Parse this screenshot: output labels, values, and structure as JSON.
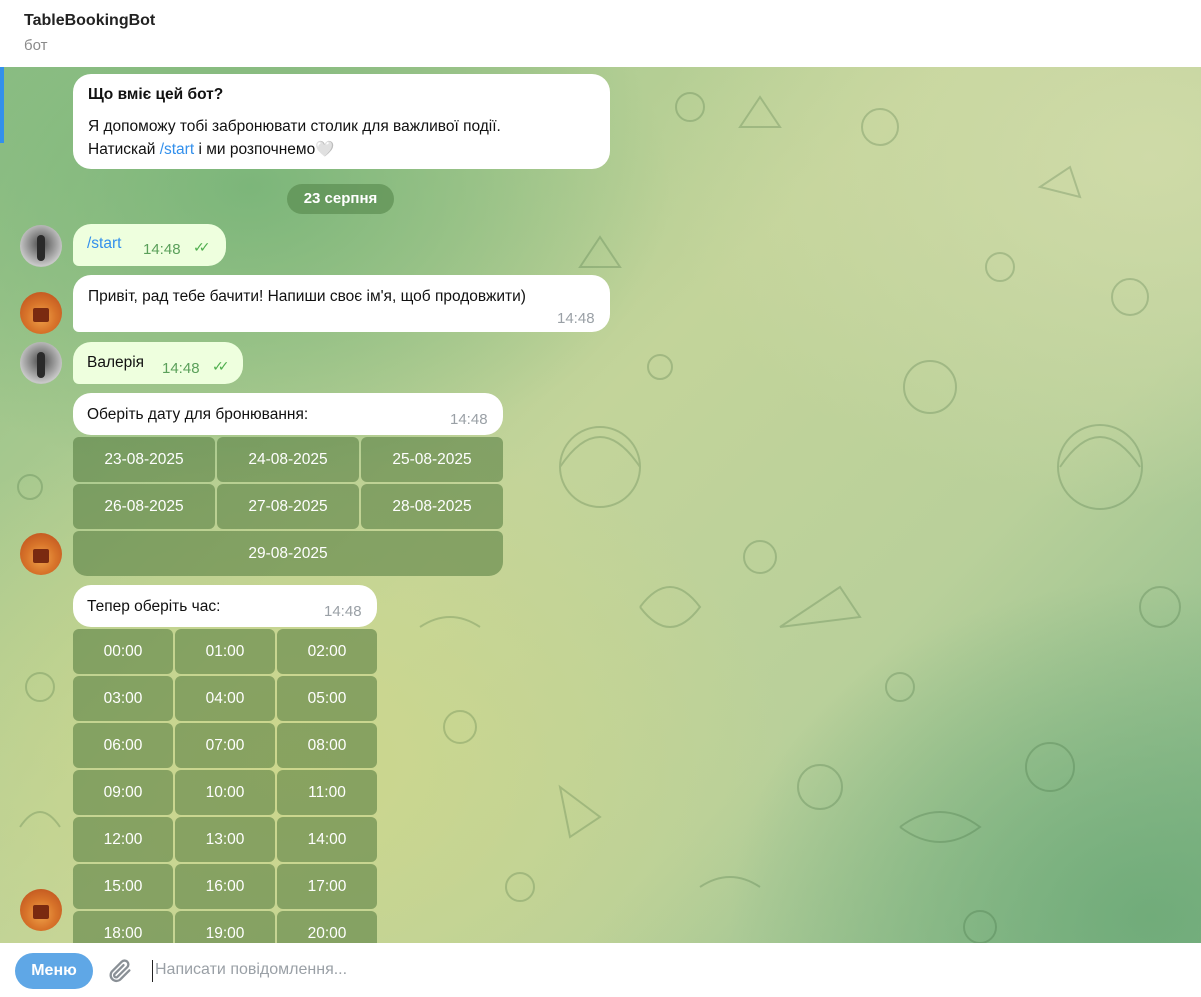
{
  "header": {
    "title": "TableBookingBot",
    "subtitle": "бот"
  },
  "messages": {
    "intro": {
      "heading": "Що вміє цей бот?",
      "line1": "Я допоможу тобі забронювати столик для важливої події.",
      "line2_before": "Натискай ",
      "line2_link": "/start",
      "line2_after": " і ми розпочнемо",
      "heart": "🤍"
    },
    "date_separator": "23 серпня",
    "start_cmd": {
      "text": "/start",
      "time": "14:48"
    },
    "greeting": {
      "text": "Привіт, рад тебе бачити! Напиши своє ім'я, щоб продовжити)",
      "time": "14:48"
    },
    "name_reply": {
      "text": "Валерія",
      "time": "14:48"
    },
    "choose_date": {
      "text": "Оберіть дату для бронювання:",
      "time": "14:48"
    },
    "choose_time": {
      "text": "Тепер оберіть час:",
      "time": "14:48"
    }
  },
  "date_buttons": [
    "23-08-2025",
    "24-08-2025",
    "25-08-2025",
    "26-08-2025",
    "27-08-2025",
    "28-08-2025",
    "29-08-2025"
  ],
  "time_buttons": [
    "00:00",
    "01:00",
    "02:00",
    "03:00",
    "04:00",
    "05:00",
    "06:00",
    "07:00",
    "08:00",
    "09:00",
    "10:00",
    "11:00",
    "12:00",
    "13:00",
    "14:00",
    "15:00",
    "16:00",
    "17:00",
    "18:00",
    "19:00",
    "20:00"
  ],
  "composer": {
    "menu_label": "Меню",
    "placeholder": "Написати повідомлення..."
  },
  "colors": {
    "accent": "#3390ec",
    "outgoing_bubble": "#eeffde",
    "ticks": "#4fae4e",
    "menu_button": "#5fa7e6"
  },
  "icons": {
    "attach": "paperclip-icon",
    "read_status": "double-check-icon"
  }
}
